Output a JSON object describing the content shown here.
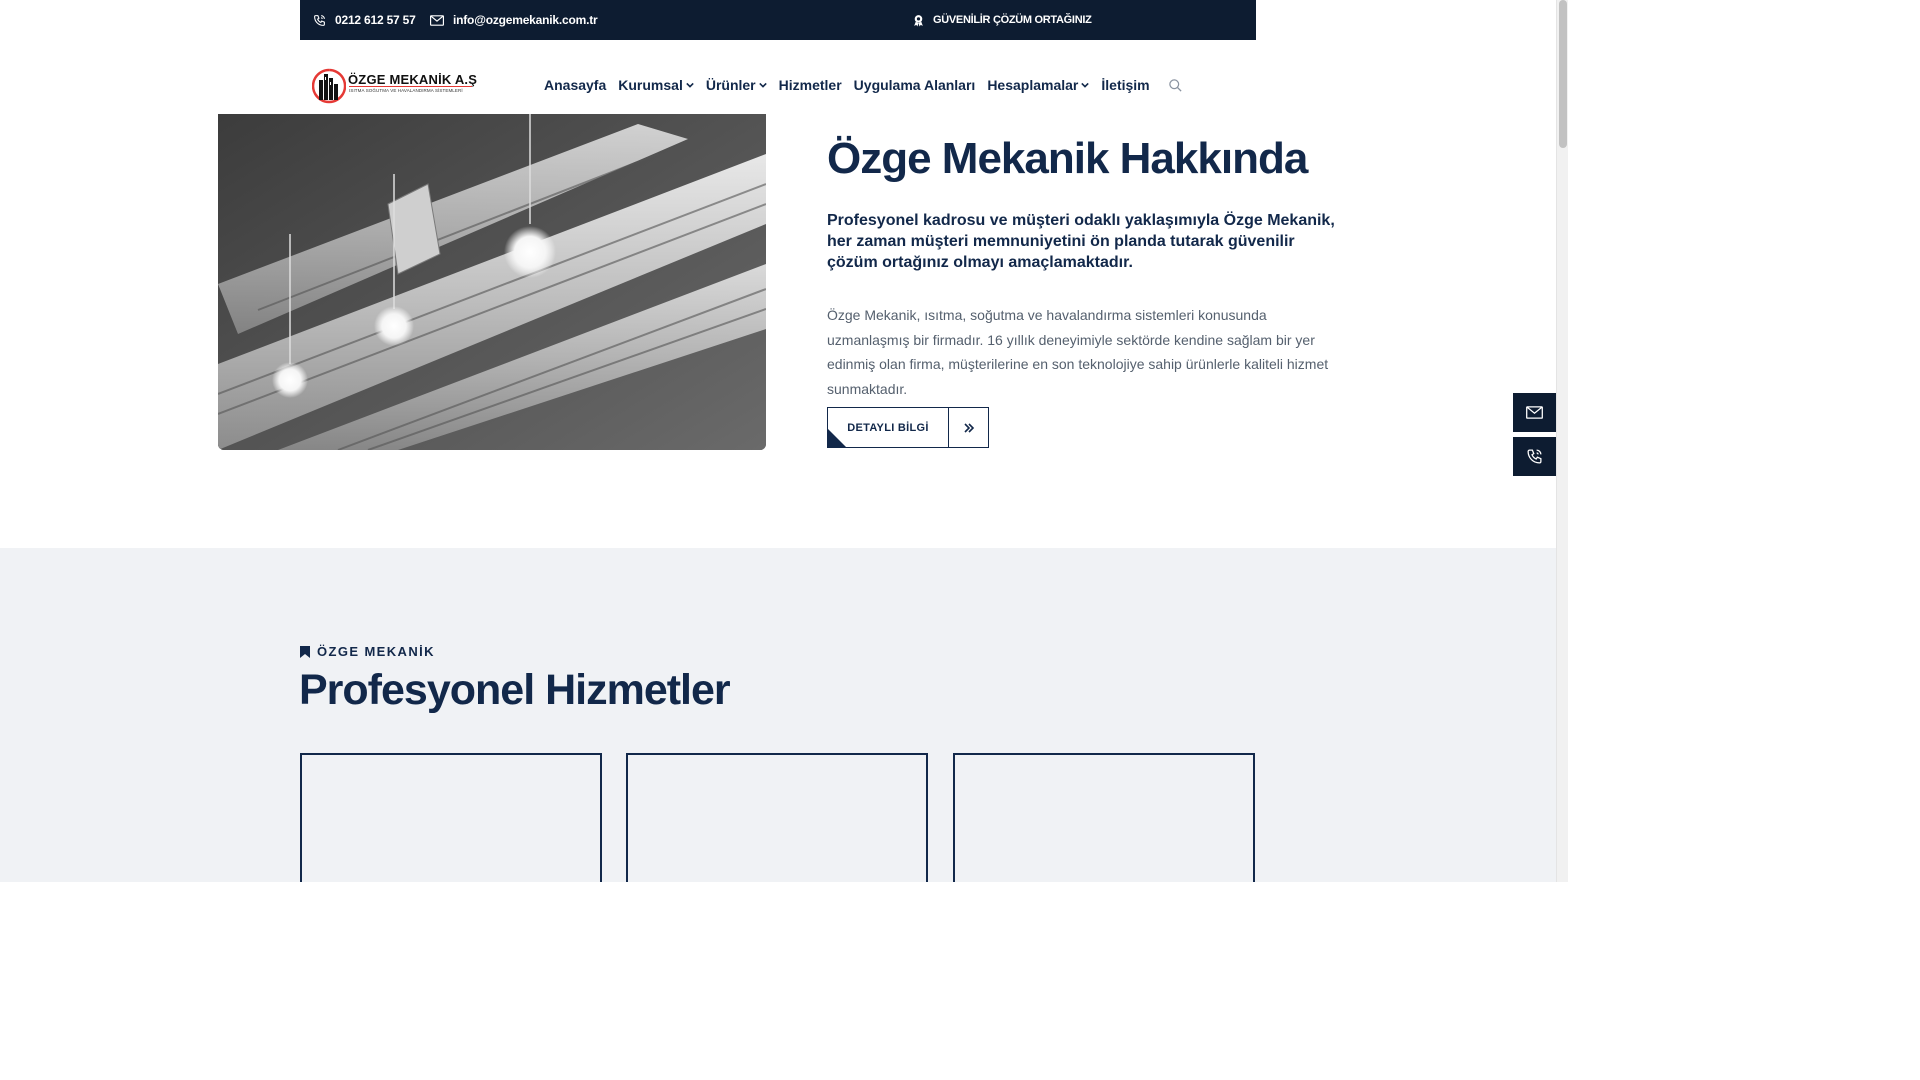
{
  "topbar": {
    "phone": "0212 612 57 57",
    "email": "info@ozgemekanik.com.tr",
    "tagline": "GÜVENİLİR ÇÖZÜM ORTAĞINIZ"
  },
  "logo": {
    "brand": "ÖZGE MEKANİK A.Ş",
    "subtitle": "ISITMA SOĞUTMA VE HAVALANDIRMA SİSTEMLERİ"
  },
  "nav": {
    "items": [
      {
        "label": "Anasayfa",
        "has_dropdown": false
      },
      {
        "label": "Kurumsal",
        "has_dropdown": true
      },
      {
        "label": "Ürünler",
        "has_dropdown": true
      },
      {
        "label": "Hizmetler",
        "has_dropdown": false
      },
      {
        "label": "Uygulama Alanları",
        "has_dropdown": false
      },
      {
        "label": "Hesaplamalar",
        "has_dropdown": true
      },
      {
        "label": "İletişim",
        "has_dropdown": false
      }
    ],
    "search_icon": "search-icon"
  },
  "about": {
    "title": "Özge Mekanik Hakkında",
    "lead": "Profesyonel kadrosu ve müşteri odaklı yaklaşımıyla Özge Mekanik, her zaman müşteri memnuniyetini ön planda tutarak güvenilir çözüm ortağınız olmayı amaçlamaktadır.",
    "body": "Özge Mekanik, ısıtma, soğutma ve havalandırma sistemleri konusunda uzmanlaşmış bir firmadır. 16 yıllık deneyimiyle sektörde kendine sağlam bir yer edinmiş olan firma, müşterilerine en son teknolojiye sahip ürünlerle kaliteli hizmet sunmaktadır.",
    "button_label": "DETAYLI BİLGİ"
  },
  "floating": {
    "mail_icon": "mail-icon",
    "phone_icon": "phone-icon"
  },
  "services": {
    "kicker": "ÖZGE MEKANİK",
    "title": "Profesyonel Hizmetler",
    "card_count": 3
  },
  "colors": {
    "navy": "#12284a",
    "dark_bar": "#0d1c31",
    "section_bg": "#f0f2f5"
  }
}
